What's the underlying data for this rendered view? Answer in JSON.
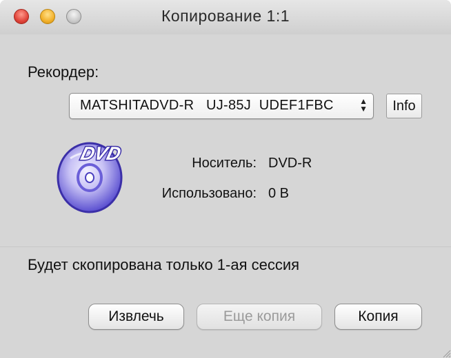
{
  "window": {
    "title": "Копирование 1:1"
  },
  "recorder": {
    "label": "Рекордер:",
    "selected_device": "MATSHITADVD-R   UJ-85J  UDEF1FBC",
    "info_label": "Info"
  },
  "disc": {
    "icon": "dvd-disc-icon",
    "badge_text": "DVD"
  },
  "media": {
    "label": "Носитель:",
    "value": "DVD-R"
  },
  "usage": {
    "label": "Использовано:",
    "value": "0 B"
  },
  "note": "Будет скопирована только 1-ая сессия",
  "buttons": {
    "eject": "Извлечь",
    "copy_more": "Еще копия",
    "copy": "Копия"
  },
  "colors": {
    "window_bg": "#d6d6d6",
    "disc_purple": "#5a4fd0",
    "close": "#e0443a",
    "minimize": "#f2b12b",
    "zoom": "#c6c6c6"
  }
}
